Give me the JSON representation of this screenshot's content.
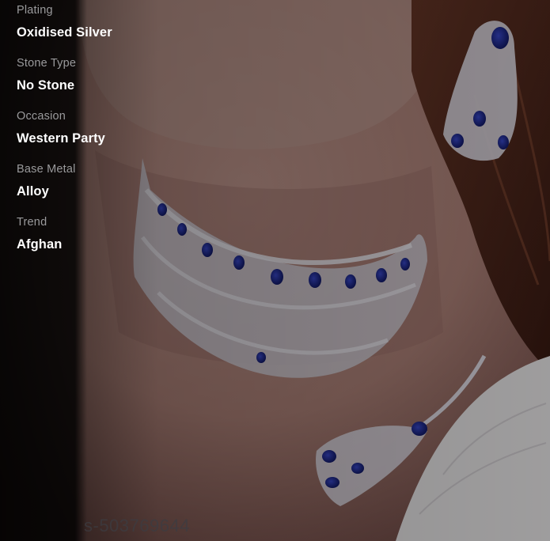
{
  "product_specs": [
    {
      "label": "Plating",
      "value": "Oxidised Silver"
    },
    {
      "label": "Stone Type",
      "value": "No Stone"
    },
    {
      "label": "Occasion",
      "value": "Western Party"
    },
    {
      "label": "Base Metal",
      "value": "Alloy"
    },
    {
      "label": "Trend",
      "value": "Afghan"
    }
  ],
  "photo": {
    "subject": "necklace-and-earring-set",
    "watermark": "s-503769644",
    "colors": {
      "skin": "#b98f86",
      "hair": "#5a2f22",
      "metal": "#e8e4ee",
      "stone": "#1d2a9e",
      "fabric": "#f3f1f2"
    }
  }
}
